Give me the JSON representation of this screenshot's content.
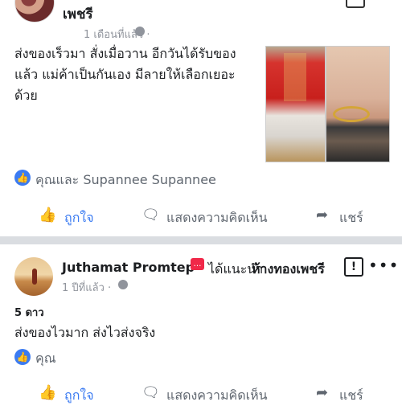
{
  "post1": {
    "author": "เพชรี",
    "time": "1 เดือนที่แล้ว ·",
    "text": "ส่งของเร็วมา สั่งเมื่อวาน อีกวันได้รับของแล้ว แม่ค้าเป็นกันเอง มีลายให้เลือกเยอะด้วย",
    "likers": "คุณและ Supannee Supannee",
    "actions": {
      "like": "ถูกใจ",
      "comment": "แสดงความคิดเห็น",
      "share": "แชร์"
    }
  },
  "post2": {
    "author": "Juthamat Promtep",
    "recommends": "ได้แนะนำ",
    "page": "ห้างทองเพชรี",
    "time": "1 ปีที่แล้ว ·",
    "rating": "5 ดาว",
    "text": "ส่งของไวมาก ส่งไวส่งจริง",
    "likers": "คุณ",
    "actions": {
      "like": "ถูกใจ",
      "comment": "แสดงความคิดเห็น",
      "share": "แชร์"
    }
  },
  "icons": {
    "like": "thumbs-up-icon",
    "comment": "speech-bubble-icon",
    "share": "share-arrow-icon",
    "globe": "globe-icon",
    "more": "more-dots-icon",
    "report": "exclamation-box-icon",
    "messenger": "messenger-icon"
  },
  "colors": {
    "like_blue": "#3b7bf2",
    "meta_gray": "#90949c",
    "recommend_red": "#f02849"
  }
}
